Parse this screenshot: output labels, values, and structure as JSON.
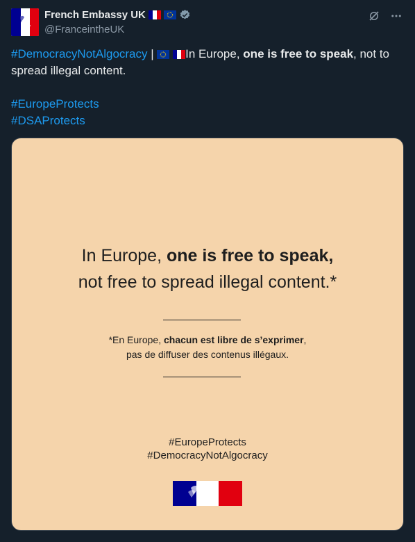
{
  "author": {
    "name": "French Embassy UK",
    "handle": "@FranceintheUK",
    "verified": true,
    "avatar_icon": "marianne-logo"
  },
  "header_actions": [
    "grok-icon",
    "more-icon"
  ],
  "tweet": {
    "tag1": "#DemocracyNotAlgocracy",
    "sep": " | ",
    "text_pre": "In Europe, ",
    "text_bold": "one is free to speak",
    "text_post": ", not to spread illegal content.",
    "tag2": "#EuropeProtects",
    "tag3": "#DSAProtects"
  },
  "card": {
    "background": "#f5d4ab",
    "line1_pre": "In Europe, ",
    "line1_bold": "one is free to speak,",
    "line2": "not free to spread illegal content.*",
    "fr_pre": "*En Europe, ",
    "fr_bold": "chacun est libre de s’exprimer",
    "fr_post": ",",
    "fr_line2": "pas de diffuser des contenus illégaux.",
    "tag1": "#EuropeProtects",
    "tag2": "#DemocracyNotAlgocracy"
  },
  "colors": {
    "background": "#15202b",
    "link": "#1d9bf0",
    "muted": "#8b98a5",
    "eu_blue": "#003399",
    "eu_gold": "#ffcc00",
    "fr_blue": "#000091",
    "fr_red": "#e1000f"
  }
}
